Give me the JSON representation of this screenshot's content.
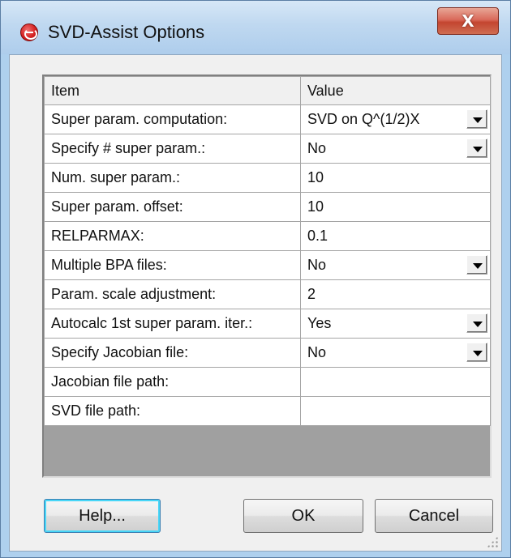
{
  "window": {
    "title": "SVD-Assist Options",
    "close_label": "X"
  },
  "grid": {
    "headers": {
      "item": "Item",
      "value": "Value"
    },
    "rows": [
      {
        "item": "Super param. computation:",
        "value": "SVD on Q^(1/2)X"
      },
      {
        "item": "Specify # super param.:",
        "value": "No"
      },
      {
        "item": "Num. super param.:",
        "value": "10"
      },
      {
        "item": "Super param. offset:",
        "value": "10"
      },
      {
        "item": "RELPARMAX:",
        "value": "0.1"
      },
      {
        "item": "Multiple BPA files:",
        "value": "No"
      },
      {
        "item": "Param. scale adjustment:",
        "value": "2"
      },
      {
        "item": "Autocalc 1st super param. iter.:",
        "value": "Yes"
      },
      {
        "item": "Specify Jacobian file:",
        "value": "No"
      },
      {
        "item": "Jacobian file path:",
        "value": ""
      },
      {
        "item": "SVD file path:",
        "value": ""
      }
    ]
  },
  "buttons": {
    "help": "Help...",
    "ok": "OK",
    "cancel": "Cancel"
  }
}
